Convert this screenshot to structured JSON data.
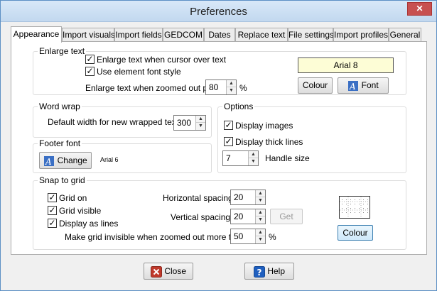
{
  "window": {
    "title": "Preferences",
    "close_glyph": "✕"
  },
  "tabs": [
    {
      "label": "Appearance"
    },
    {
      "label": "Import visuals"
    },
    {
      "label": "Import fields"
    },
    {
      "label": "GEDCOM"
    },
    {
      "label": "Dates"
    },
    {
      "label": "Replace text"
    },
    {
      "label": "File settings"
    },
    {
      "label": "Import profiles"
    },
    {
      "label": "General"
    }
  ],
  "enlarge_text": {
    "title": "Enlarge text",
    "cursor_over_label": "Enlarge text when cursor over text",
    "cursor_over_checked": true,
    "element_font_label": "Use element font style",
    "element_font_checked": true,
    "zoomed_label": "Enlarge text when zoomed out past",
    "zoomed_value": "80",
    "zoomed_unit": "%",
    "font_preview": "Arial 8",
    "colour_button": "Colour",
    "font_button": "Font"
  },
  "word_wrap": {
    "title": "Word wrap",
    "width_label": "Default width for new wrapped text",
    "width_value": "300"
  },
  "footer_font": {
    "title": "Footer font",
    "change_button": "Change",
    "font_name": "Arial 6"
  },
  "options": {
    "title": "Options",
    "display_images_label": "Display images",
    "display_images_checked": true,
    "thick_lines_label": "Display thick lines",
    "thick_lines_checked": true,
    "handle_size_value": "7",
    "handle_size_label": "Handle size"
  },
  "snap": {
    "title": "Snap to grid",
    "grid_on_label": "Grid on",
    "grid_on_checked": true,
    "grid_visible_label": "Grid visible",
    "grid_visible_checked": true,
    "as_lines_label": "Display as lines",
    "as_lines_checked": true,
    "h_spacing_label": "Horizontal spacing",
    "h_spacing_value": "20",
    "v_spacing_label": "Vertical spacing",
    "v_spacing_value": "20",
    "get_button": "Get",
    "invisible_label": "Make grid invisible when zoomed out more than",
    "invisible_value": "50",
    "invisible_unit": "%",
    "colour_button": "Colour"
  },
  "footer": {
    "close_button": "Close",
    "help_button": "Help"
  },
  "colors": {
    "font_preview_bg": "#fdfdd6",
    "close_icon": "#c0392b",
    "help_icon": "#1f5fbf"
  }
}
